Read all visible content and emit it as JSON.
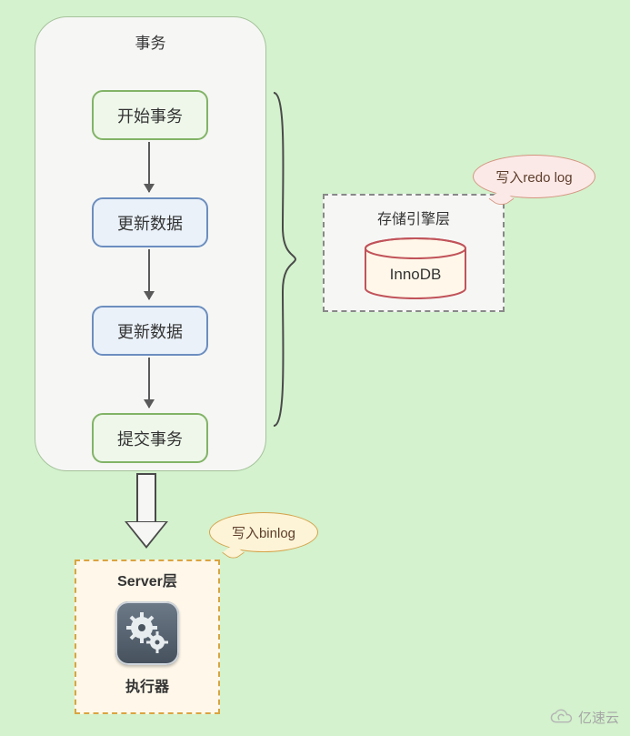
{
  "transaction": {
    "title": "事务",
    "steps": [
      "开始事务",
      "更新数据",
      "更新数据",
      "提交事务"
    ]
  },
  "storage": {
    "title": "存储引擎层",
    "engine": "InnoDB"
  },
  "bubbles": {
    "redo": "写入redo log",
    "binlog": "写入binlog"
  },
  "server": {
    "title": "Server层",
    "executor": "执行器"
  },
  "watermark": "亿速云"
}
